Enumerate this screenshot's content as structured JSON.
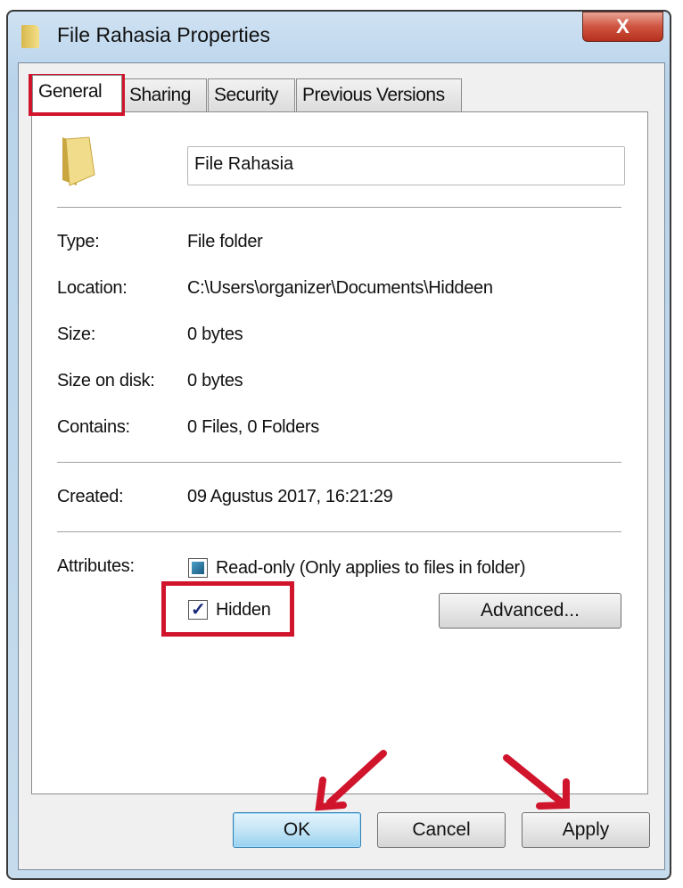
{
  "window": {
    "title": "File Rahasia Properties",
    "close_label": "X"
  },
  "tabs": [
    {
      "label": "General",
      "active": true
    },
    {
      "label": "Sharing"
    },
    {
      "label": "Security"
    },
    {
      "label": "Previous Versions"
    }
  ],
  "general": {
    "name_value": "File Rahasia",
    "rows": [
      {
        "label": "Type:",
        "value": "File folder"
      },
      {
        "label": "Location:",
        "value": "C:\\Users\\organizer\\Documents\\Hiddeen"
      },
      {
        "label": "Size:",
        "value": "0 bytes"
      },
      {
        "label": "Size on disk:",
        "value": "0 bytes"
      },
      {
        "label": "Contains:",
        "value": "0 Files, 0 Folders"
      }
    ],
    "created_label": "Created:",
    "created_value": "09 Agustus 2017, 16:21:29",
    "attributes_label": "Attributes:",
    "readonly_label": "Read-only (Only applies to files in folder)",
    "readonly_state": "indeterminate",
    "hidden_label": "Hidden",
    "hidden_checked": true,
    "advanced_label": "Advanced..."
  },
  "buttons": {
    "ok": "OK",
    "cancel": "Cancel",
    "apply": "Apply"
  },
  "annotation_color": "#d0142c"
}
